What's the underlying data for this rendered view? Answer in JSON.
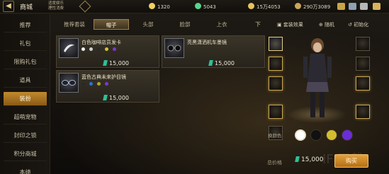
{
  "header": {
    "back_glyph": "◀",
    "title": "商城",
    "notice_line1": "适度娱乐",
    "notice_line2": "理性消费",
    "currencies": [
      {
        "icon": "coin-icon",
        "color": "#f3d060",
        "value": "1320"
      },
      {
        "icon": "coupon-icon",
        "color": "#5bd48c",
        "value": "5043"
      },
      {
        "icon": "gold-icon",
        "color": "#e8c35a",
        "value": "15万4053"
      },
      {
        "icon": "gem-icon",
        "color": "#c9a85c",
        "value": "290万3089"
      }
    ]
  },
  "sidebar": {
    "items": [
      {
        "label": "推荐"
      },
      {
        "label": "礼包"
      },
      {
        "label": "限购礼包"
      },
      {
        "label": "道具"
      },
      {
        "label": "装扮",
        "active": true
      },
      {
        "label": "超萌宠物"
      },
      {
        "label": "封印之锁"
      },
      {
        "label": "积分商城"
      },
      {
        "label": "本绩"
      }
    ]
  },
  "tabs": {
    "items": [
      {
        "label": "推荐套装"
      },
      {
        "label": "帽子",
        "active": true
      },
      {
        "label": "头部"
      },
      {
        "label": "脸部"
      },
      {
        "label": "上衣"
      }
    ],
    "next_label": "下"
  },
  "products": [
    {
      "name": "白色咖啡店员发卡",
      "price": "15,000",
      "colors": [
        "#f2f2f2",
        "#cfcfcf",
        "#2a2a2a",
        "#d7c23a",
        "#7a3ad0"
      ]
    },
    {
      "name": "亮黑潇洒机车墨镜",
      "price": "15,000",
      "colors": []
    },
    {
      "name": "蓝色古典未来护目镜",
      "price": "15,000",
      "colors": [
        "#2a2a2a",
        "#2b6fd6",
        "#b4a230",
        "#7a3ad0"
      ]
    }
  ],
  "preview": {
    "set_effect_label": "套装效果",
    "random_label": "随机",
    "init_label": "初始化",
    "color_label": "换颜色",
    "swatches": [
      "#ffffff",
      "#111111",
      "#d4bd30",
      "#6a2dd8"
    ]
  },
  "footer": {
    "total_label": "总价格",
    "total_value": "15,000",
    "buy_label": "购买",
    "watermark": "IF 下载"
  },
  "theme": {
    "accent": "#c08a2e",
    "panel": "#3a3426"
  }
}
